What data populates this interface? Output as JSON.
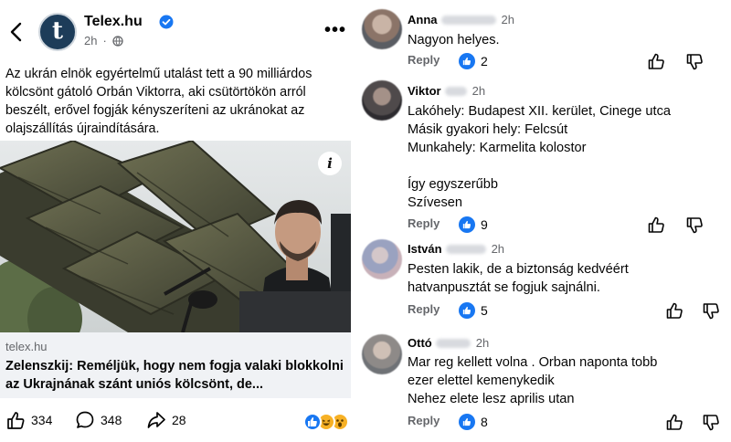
{
  "post": {
    "page_name": "Telex.hu",
    "avatar_letter": "t",
    "time": "2h",
    "text": "Az ukrán elnök egyértelmű utalást tett a 90 milliárdos kölcsönt gátoló Orbán Viktorra, aki csütörtökön arról beszélt, erővel fogják kényszeríteni az ukránokat az olajszállítás újraindítására.",
    "link_domain": "telex.hu",
    "link_title": "Zelenszkij: Reméljük, hogy nem fogja valaki blokkolni az Ukrajnának szánt uniós kölcsönt, de...",
    "likes": "334",
    "comments": "348",
    "shares": "28",
    "colors": {
      "accent": "#1877f2",
      "avatar_bg": "#1d3c59",
      "link_bg": "#f0f2f5"
    }
  },
  "comments": [
    {
      "name": "Anna",
      "time": "2h",
      "lines": [
        "Nagyon helyes."
      ],
      "reply": "Reply",
      "likes": "2"
    },
    {
      "name": "Viktor",
      "time": "2h",
      "lines": [
        "Lakóhely: Budapest XII. kerület, Cinege utca",
        "Másik gyakori hely: Felcsút",
        "Munkahely: Karmelita kolostor",
        "",
        "Így egyszerűbb",
        "Szívesen"
      ],
      "reply": "Reply",
      "likes": "9"
    },
    {
      "name": "István",
      "time": "2h",
      "lines": [
        "Pesten lakik, de a biztonság kedvéért",
        "hatvanpusztát se fogjuk sajnálni."
      ],
      "reply": "Reply",
      "likes": "5"
    },
    {
      "name": "Ottó",
      "time": "2h",
      "lines": [
        "Mar reg kellett volna . Orban naponta tobb",
        "ezer elettel kemenykedik",
        "Nehez elete lesz aprilis utan"
      ],
      "reply": "Reply",
      "likes": "8"
    }
  ]
}
